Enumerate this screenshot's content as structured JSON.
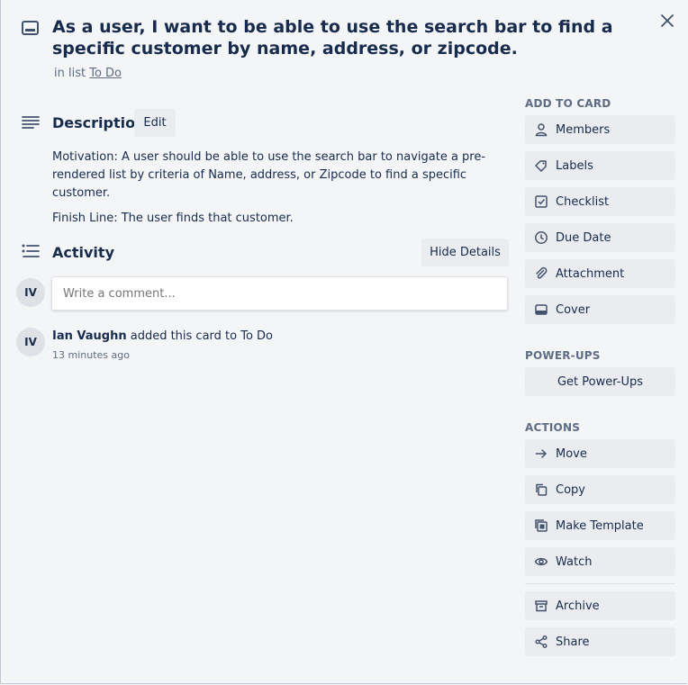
{
  "card": {
    "title": "As a user, I want to be able to use the search bar to find a specific customer by name, address, or zipcode.",
    "in_list_prefix": "in list",
    "list_name": "To Do"
  },
  "description": {
    "heading": "Description",
    "edit_label": "Edit",
    "paragraphs": [
      "Motivation: A user should be able to use the search bar to navigate a pre-rendered list by criteria of Name, address, or Zipcode to find a specific customer.",
      "Finish Line: The user finds that customer."
    ]
  },
  "activity": {
    "heading": "Activity",
    "hide_details_label": "Hide Details",
    "comment_placeholder": "Write a comment...",
    "user_initials": "IV",
    "entries": [
      {
        "initials": "IV",
        "user": "Ian Vaughn",
        "action": " added this card to To Do",
        "time": "13 minutes ago"
      }
    ]
  },
  "sidebar": {
    "add_to_card_heading": "ADD TO CARD",
    "add_to_card": [
      {
        "label": "Members",
        "icon": "person-icon"
      },
      {
        "label": "Labels",
        "icon": "tag-icon"
      },
      {
        "label": "Checklist",
        "icon": "checkbox-icon"
      },
      {
        "label": "Due Date",
        "icon": "clock-icon"
      },
      {
        "label": "Attachment",
        "icon": "paperclip-icon"
      },
      {
        "label": "Cover",
        "icon": "cover-icon"
      }
    ],
    "power_ups_heading": "POWER-UPS",
    "get_power_ups_label": "Get Power-Ups",
    "actions_heading": "ACTIONS",
    "actions": [
      {
        "label": "Move",
        "icon": "arrow-right-icon"
      },
      {
        "label": "Copy",
        "icon": "copy-icon"
      },
      {
        "label": "Make Template",
        "icon": "template-icon"
      },
      {
        "label": "Watch",
        "icon": "eye-icon"
      }
    ],
    "actions_secondary": [
      {
        "label": "Archive",
        "icon": "archive-icon"
      },
      {
        "label": "Share",
        "icon": "share-icon"
      }
    ]
  },
  "colors": {
    "background": "#f4f5f7",
    "button": "#ebecf0",
    "text": "#172b4d",
    "subtle_text": "#5e6c84"
  }
}
